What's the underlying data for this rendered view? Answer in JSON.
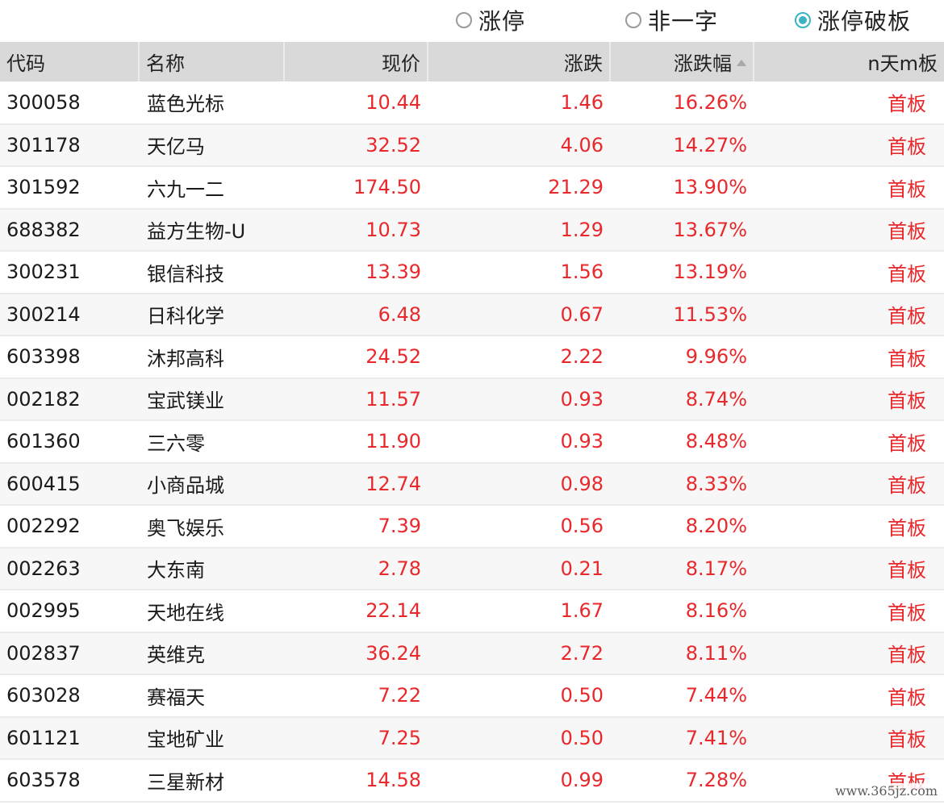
{
  "filters": [
    {
      "label": "涨停",
      "selected": false
    },
    {
      "label": "非一字",
      "selected": false
    },
    {
      "label": "涨停破板",
      "selected": true
    }
  ],
  "columns": {
    "code": "代码",
    "name": "名称",
    "price": "现价",
    "change": "涨跌",
    "change_pct": "涨跌幅",
    "boards": "n天m板"
  },
  "sort": {
    "column": "change_pct",
    "direction": "desc"
  },
  "rows": [
    {
      "code": "300058",
      "name": "蓝色光标",
      "price": "10.44",
      "change": "1.46",
      "change_pct": "16.26%",
      "boards": "首板"
    },
    {
      "code": "301178",
      "name": "天亿马",
      "price": "32.52",
      "change": "4.06",
      "change_pct": "14.27%",
      "boards": "首板"
    },
    {
      "code": "301592",
      "name": "六九一二",
      "price": "174.50",
      "change": "21.29",
      "change_pct": "13.90%",
      "boards": "首板"
    },
    {
      "code": "688382",
      "name": "益方生物-U",
      "price": "10.73",
      "change": "1.29",
      "change_pct": "13.67%",
      "boards": "首板"
    },
    {
      "code": "300231",
      "name": "银信科技",
      "price": "13.39",
      "change": "1.56",
      "change_pct": "13.19%",
      "boards": "首板"
    },
    {
      "code": "300214",
      "name": "日科化学",
      "price": "6.48",
      "change": "0.67",
      "change_pct": "11.53%",
      "boards": "首板"
    },
    {
      "code": "603398",
      "name": "沐邦高科",
      "price": "24.52",
      "change": "2.22",
      "change_pct": "9.96%",
      "boards": "首板"
    },
    {
      "code": "002182",
      "name": "宝武镁业",
      "price": "11.57",
      "change": "0.93",
      "change_pct": "8.74%",
      "boards": "首板"
    },
    {
      "code": "601360",
      "name": "三六零",
      "price": "11.90",
      "change": "0.93",
      "change_pct": "8.48%",
      "boards": "首板"
    },
    {
      "code": "600415",
      "name": "小商品城",
      "price": "12.74",
      "change": "0.98",
      "change_pct": "8.33%",
      "boards": "首板"
    },
    {
      "code": "002292",
      "name": "奥飞娱乐",
      "price": "7.39",
      "change": "0.56",
      "change_pct": "8.20%",
      "boards": "首板"
    },
    {
      "code": "002263",
      "name": "大东南",
      "price": "2.78",
      "change": "0.21",
      "change_pct": "8.17%",
      "boards": "首板"
    },
    {
      "code": "002995",
      "name": "天地在线",
      "price": "22.14",
      "change": "1.67",
      "change_pct": "8.16%",
      "boards": "首板"
    },
    {
      "code": "002837",
      "name": "英维克",
      "price": "36.24",
      "change": "2.72",
      "change_pct": "8.11%",
      "boards": "首板"
    },
    {
      "code": "603028",
      "name": "赛福天",
      "price": "7.22",
      "change": "0.50",
      "change_pct": "7.44%",
      "boards": "首板"
    },
    {
      "code": "601121",
      "name": "宝地矿业",
      "price": "7.25",
      "change": "0.50",
      "change_pct": "7.41%",
      "boards": "首板"
    },
    {
      "code": "603578",
      "name": "三星新材",
      "price": "14.58",
      "change": "0.99",
      "change_pct": "7.28%",
      "boards": "首板"
    }
  ],
  "watermark": "www.365jz.com",
  "colors": {
    "up": "#e8282b",
    "radio_selected": "#3cb3c4",
    "header_bg": "#d9d9d9"
  }
}
